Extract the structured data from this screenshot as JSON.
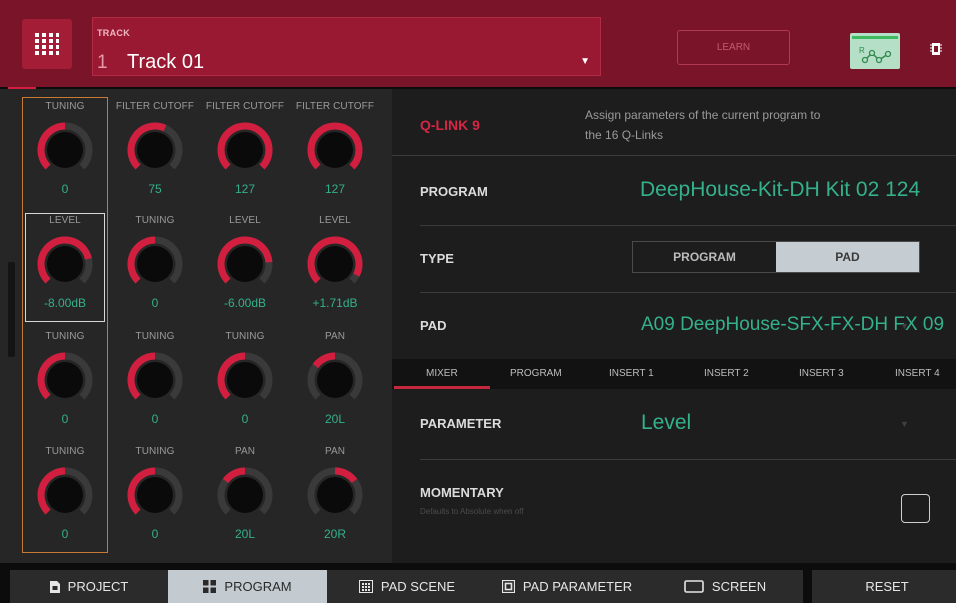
{
  "header": {
    "track_label": "TRACK",
    "track_number": "1",
    "track_name": "Track 01",
    "learn_label": "LEARN",
    "auto_badge": "R",
    "accent_color": "#7a1428"
  },
  "knobs": [
    {
      "label": "TUNING",
      "value": "0"
    },
    {
      "label": "FILTER CUTOFF",
      "value": "75"
    },
    {
      "label": "FILTER CUTOFF",
      "value": "127"
    },
    {
      "label": "FILTER CUTOFF",
      "value": "127"
    },
    {
      "label": "LEVEL",
      "value": "-8.00dB"
    },
    {
      "label": "TUNING",
      "value": "0"
    },
    {
      "label": "LEVEL",
      "value": "-6.00dB"
    },
    {
      "label": "LEVEL",
      "value": "+1.71dB"
    },
    {
      "label": "TUNING",
      "value": "0"
    },
    {
      "label": "TUNING",
      "value": "0"
    },
    {
      "label": "TUNING",
      "value": "0"
    },
    {
      "label": "PAN",
      "value": "20L"
    },
    {
      "label": "TUNING",
      "value": "0"
    },
    {
      "label": "TUNING",
      "value": "0"
    },
    {
      "label": "PAN",
      "value": "20L"
    },
    {
      "label": "PAN",
      "value": "20R"
    }
  ],
  "qlink": {
    "title": "Q-LINK 9",
    "description": "Assign parameters of the current program to the 16 Q-Links"
  },
  "program": {
    "label": "PROGRAM",
    "value": "DeepHouse-Kit-DH Kit 02 124"
  },
  "type": {
    "label": "TYPE",
    "options": [
      "PROGRAM",
      "PAD"
    ],
    "selected": "PAD"
  },
  "pad": {
    "label": "PAD",
    "value": "A09 DeepHouse-SFX-FX-DH FX 09"
  },
  "tabs": [
    "MIXER",
    "PROGRAM",
    "INSERT 1",
    "INSERT 2",
    "INSERT 3",
    "INSERT 4"
  ],
  "active_tab": "MIXER",
  "parameter": {
    "label": "PARAMETER",
    "value": "Level"
  },
  "momentary": {
    "label": "MOMENTARY",
    "sublabel": "Defaults to Absolute when off",
    "checked": false
  },
  "bottom_nav": {
    "project": "PROJECT",
    "program": "PROGRAM",
    "pad_scene": "PAD SCENE",
    "pad_parameter": "PAD PARAMETER",
    "screen": "SCREEN",
    "reset": "RESET",
    "active": "PROGRAM"
  },
  "colors": {
    "value_green": "#34b08b",
    "knob_red": "#d21f40",
    "highlight_orange": "#c77a36"
  }
}
